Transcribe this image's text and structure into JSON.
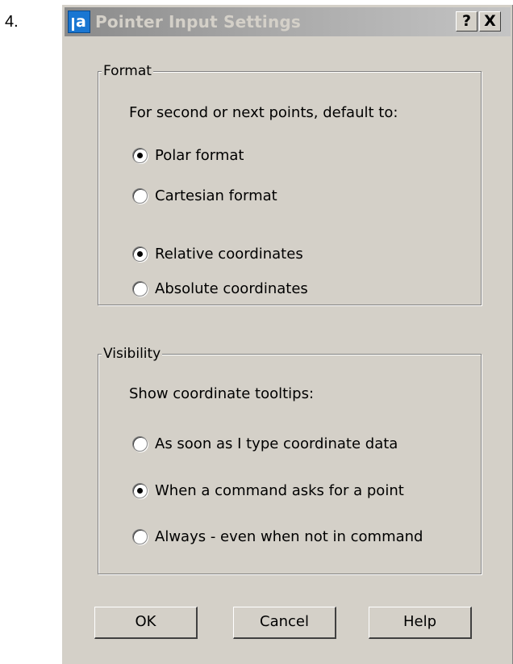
{
  "step": "4.",
  "dialog": {
    "title": "Pointer Input Settings",
    "app_icon": "autocad-icon",
    "help_button": "?",
    "close_button": "X"
  },
  "format_group": {
    "label": "Format",
    "prompt": "For second or next points, default to:",
    "options": [
      {
        "label": "Polar format",
        "checked": true
      },
      {
        "label": "Cartesian format",
        "checked": false
      },
      {
        "label": "Relative coordinates",
        "checked": true
      },
      {
        "label": "Absolute coordinates",
        "checked": false
      }
    ]
  },
  "visibility_group": {
    "label": "Visibility",
    "prompt": "Show coordinate tooltips:",
    "options": [
      {
        "label": "As soon as I type coordinate data",
        "checked": false
      },
      {
        "label": "When a command asks for a point",
        "checked": true
      },
      {
        "label": "Always - even when not in command",
        "checked": false
      }
    ]
  },
  "buttons": {
    "ok": "OK",
    "cancel": "Cancel",
    "help": "Help"
  }
}
